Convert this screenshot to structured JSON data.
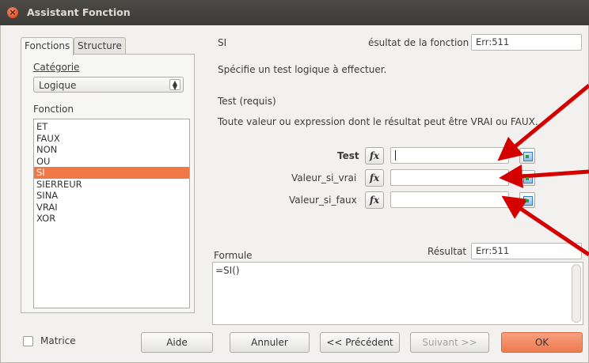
{
  "window": {
    "title": "Assistant Fonction",
    "close_symbol": "×"
  },
  "tabs": [
    {
      "label": "Fonctions"
    },
    {
      "label": "Structure"
    }
  ],
  "left": {
    "category_label": "Catégorie",
    "category_value": "Logique",
    "function_label": "Fonction",
    "functions": [
      "ET",
      "FAUX",
      "NON",
      "OU",
      "SI",
      "SIERREUR",
      "SINA",
      "VRAI",
      "XOR"
    ],
    "selected_index": 4
  },
  "function": {
    "name": "SI",
    "result_label": "ésultat de la fonction",
    "result_value": "Err:511",
    "description": "Spécifie un test logique à effectuer.",
    "param_title": "Test (requis)",
    "param_description": "Toute valeur ou expression dont le résultat peut être VRAI ou FAUX."
  },
  "args": [
    {
      "label": "Test",
      "value": "",
      "bold": true
    },
    {
      "label": "Valeur_si_vrai",
      "value": "",
      "bold": false
    },
    {
      "label": "Valeur_si_faux",
      "value": "",
      "bold": false
    }
  ],
  "fx_symbol": "fx",
  "formula": {
    "label": "Formule",
    "result_label": "Résultat",
    "result_value": "Err:511",
    "text": "=SI()"
  },
  "checkbox": {
    "label": "Matrice",
    "checked": false
  },
  "buttons": {
    "help": "Aide",
    "cancel": "Annuler",
    "previous": "<< Précédent",
    "next": "Suivant >>",
    "ok": "OK"
  },
  "colors": {
    "accent": "#f07746",
    "annotation_arrow": "#d40000"
  },
  "icons": [
    "close-icon",
    "fx-icon",
    "shrink-icon",
    "spin-icon"
  ]
}
